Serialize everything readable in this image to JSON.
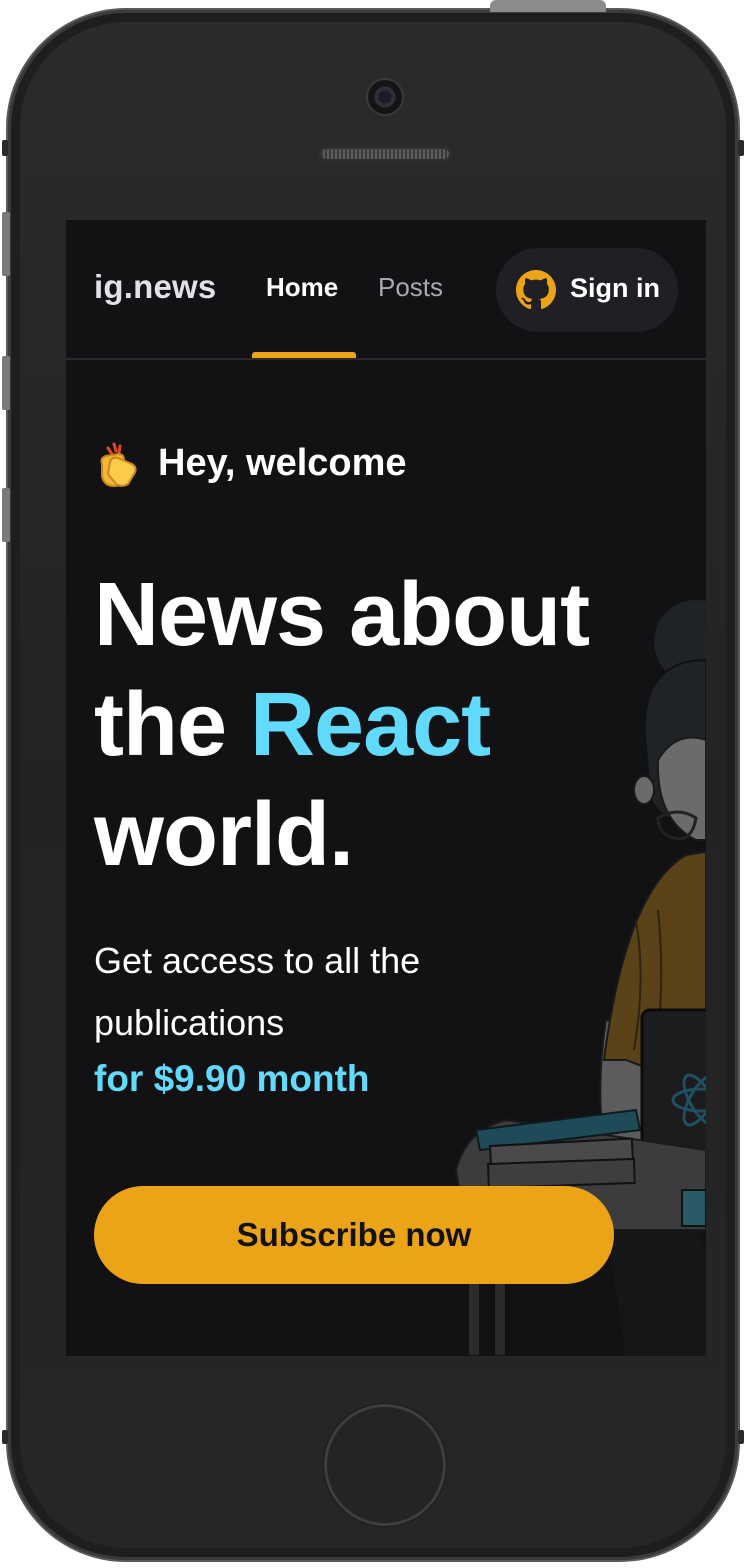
{
  "header": {
    "logo": "ig.news",
    "nav": {
      "home_label": "Home",
      "posts_label": "Posts"
    },
    "signin": {
      "label": "Sign in",
      "icon": "github-icon"
    }
  },
  "hero": {
    "welcome_icon": "clapping-hands-icon",
    "welcome_text": "Hey, welcome",
    "headline_part1": "News about",
    "headline_the": "the",
    "headline_accent": "React",
    "headline_part2": "world.",
    "description": "Get access to all the publications",
    "price": "for $9.90 month",
    "subscribe_label": "Subscribe now",
    "illustration": "woman-with-laptop-illustration"
  },
  "colors": {
    "background": "#121214",
    "accent_yellow": "#eba417",
    "accent_cyan": "#61dafb",
    "text": "#ffffff",
    "muted": "#a8a8b3"
  }
}
